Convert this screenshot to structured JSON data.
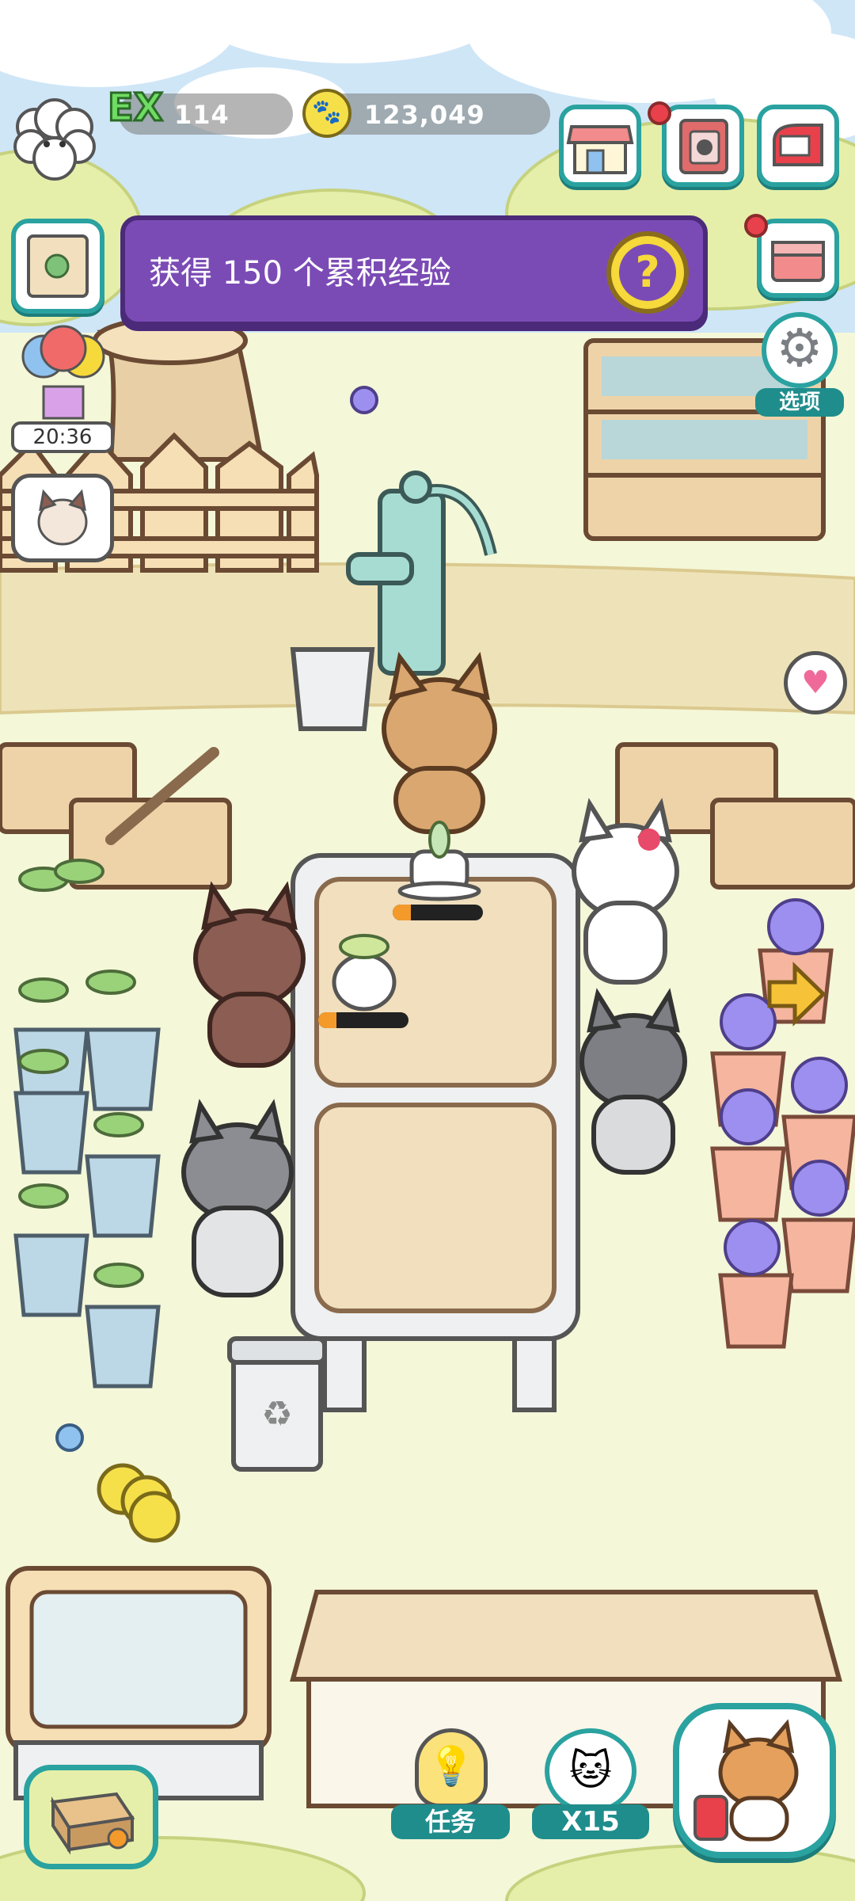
{
  "hud": {
    "level_badge": "EX",
    "level_value": "114",
    "coins_value": "123,049",
    "timer": "20:36"
  },
  "banner": {
    "message": "获得 150 个累积经验",
    "help_glyph": "?"
  },
  "side_menu": {
    "options_label": "选项"
  },
  "bottom_bar": {
    "tasks_label": "任务",
    "multiplier_label": "X15"
  },
  "progress": {
    "plant_1": 0.2,
    "plant_2": 0.2
  },
  "colors": {
    "teal": "#2aa2a0",
    "banner_purple": "#7b4bb5",
    "ground": "#f4f7d8",
    "path": "#eee3b8"
  },
  "icons": [
    "sheep-avatar-icon",
    "coin-paw-icon",
    "shop-icon",
    "cat-album-icon",
    "mailbox-icon",
    "treasure-map-icon",
    "storage-box-icon",
    "gear-icon",
    "balloon-gift-icon",
    "cat-bubble-icon",
    "heart-bubble-icon",
    "arrow-right-icon",
    "lightbulb-icon",
    "delivery-box-icon",
    "cat-portrait-icon"
  ]
}
